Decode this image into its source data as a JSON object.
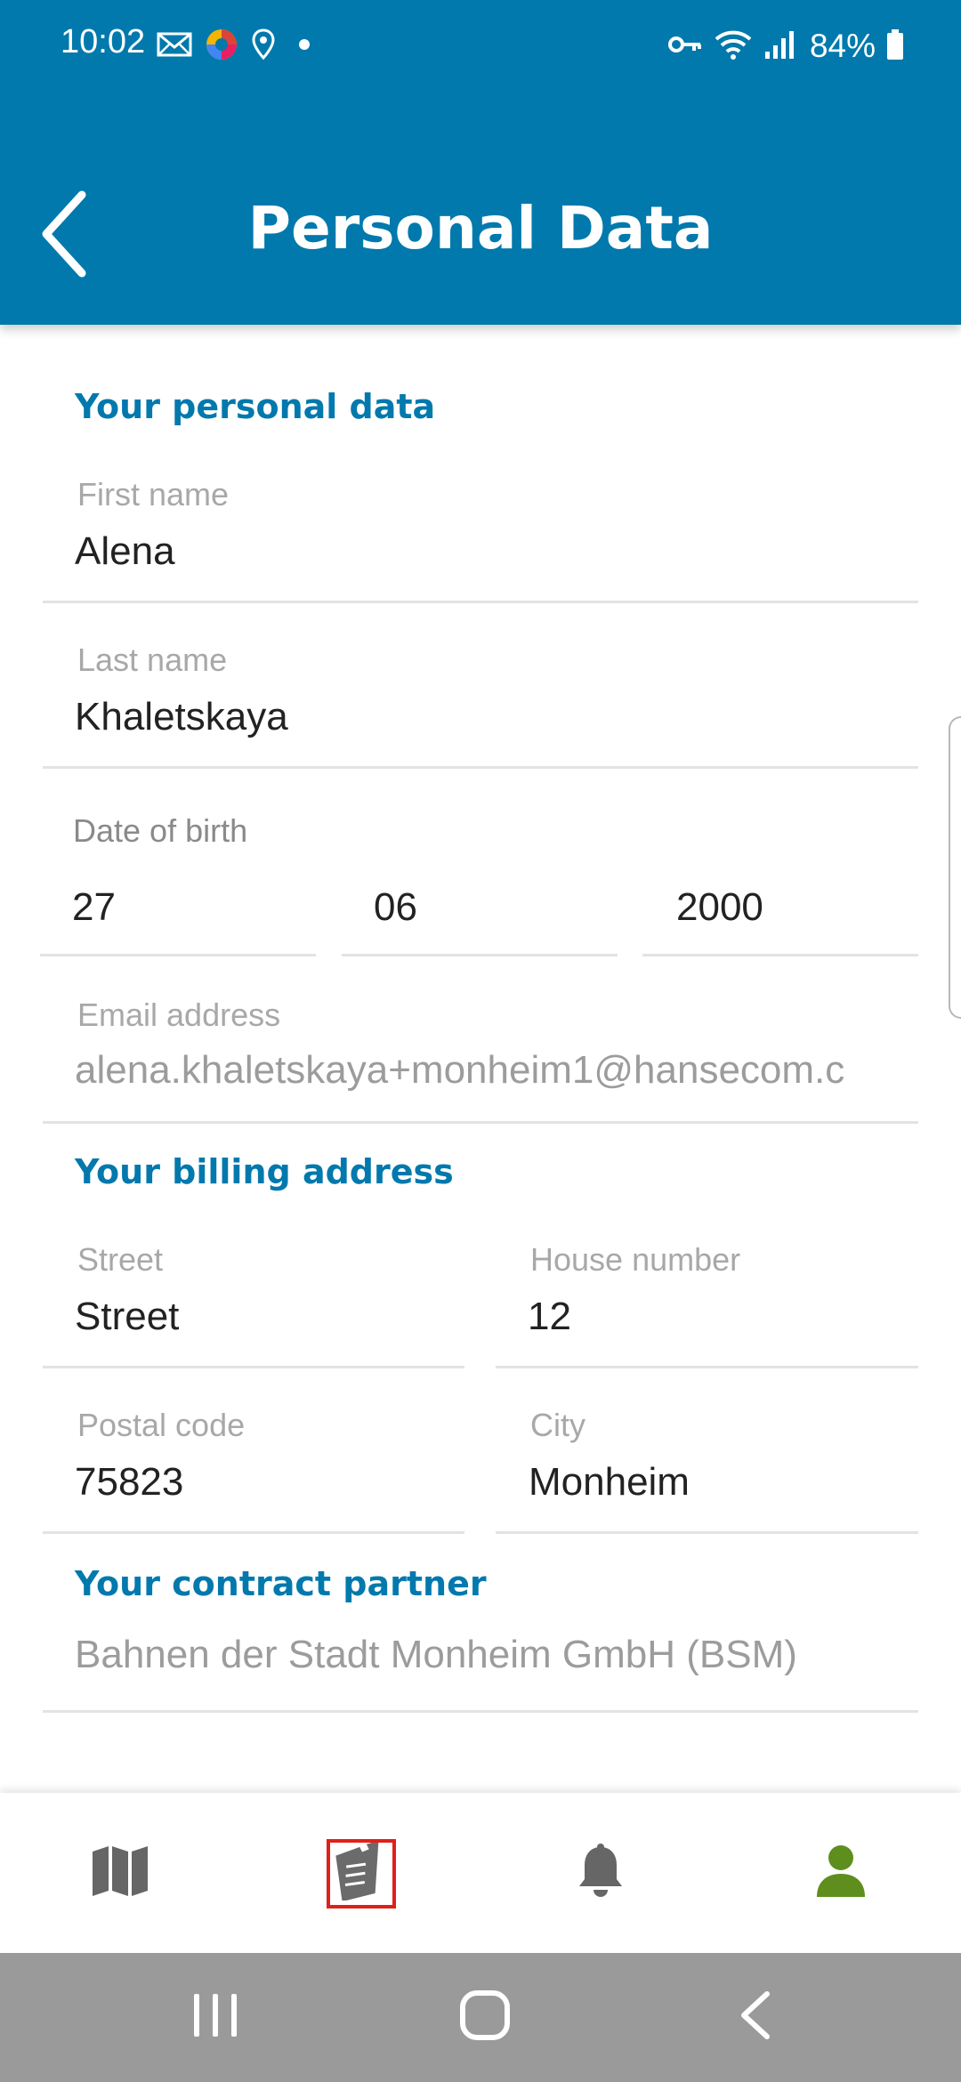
{
  "status_bar": {
    "time": "10:02",
    "battery": "84%",
    "icons_left": [
      "mail-icon",
      "colorful-app-icon",
      "location-icon",
      "dot-icon"
    ],
    "icons_right": [
      "vpn-key-icon",
      "wifi-icon",
      "signal-icon",
      "battery-icon"
    ]
  },
  "header": {
    "title": "Personal Data",
    "back_icon": "chevron-left-icon",
    "background_color": "#0179ad"
  },
  "personal": {
    "section_title": "Your personal data",
    "first_name": {
      "label": "First name",
      "value": "Alena"
    },
    "last_name": {
      "label": "Last name",
      "value": "Khaletskaya"
    },
    "dob": {
      "label": "Date of birth",
      "day": "27",
      "month": "06",
      "year": "2000"
    },
    "email": {
      "label": "Email address",
      "value": "alena.khaletskaya+monheim1@hansecom.c"
    }
  },
  "billing": {
    "section_title": "Your billing address",
    "street": {
      "label": "Street",
      "value": "Street"
    },
    "house_number": {
      "label": "House number",
      "value": "12"
    },
    "postal_code": {
      "label": "Postal code",
      "value": "75823"
    },
    "city": {
      "label": "City",
      "value": "Monheim"
    }
  },
  "contract": {
    "section_title": "Your contract partner",
    "value": "Bahnen der Stadt Monheim GmbH (BSM)"
  },
  "bottom_nav": {
    "items": [
      {
        "icon": "map-icon",
        "active": false
      },
      {
        "icon": "ticket-icon",
        "active": false,
        "highlighted": true
      },
      {
        "icon": "bell-icon",
        "active": false
      },
      {
        "icon": "person-icon",
        "active": true
      }
    ],
    "active_color": "#5e8e1e",
    "inactive_color": "#666666",
    "highlight_color": "#e0201b"
  },
  "system_nav": {
    "buttons": [
      "recent-apps-icon",
      "home-icon",
      "back-icon"
    ]
  }
}
